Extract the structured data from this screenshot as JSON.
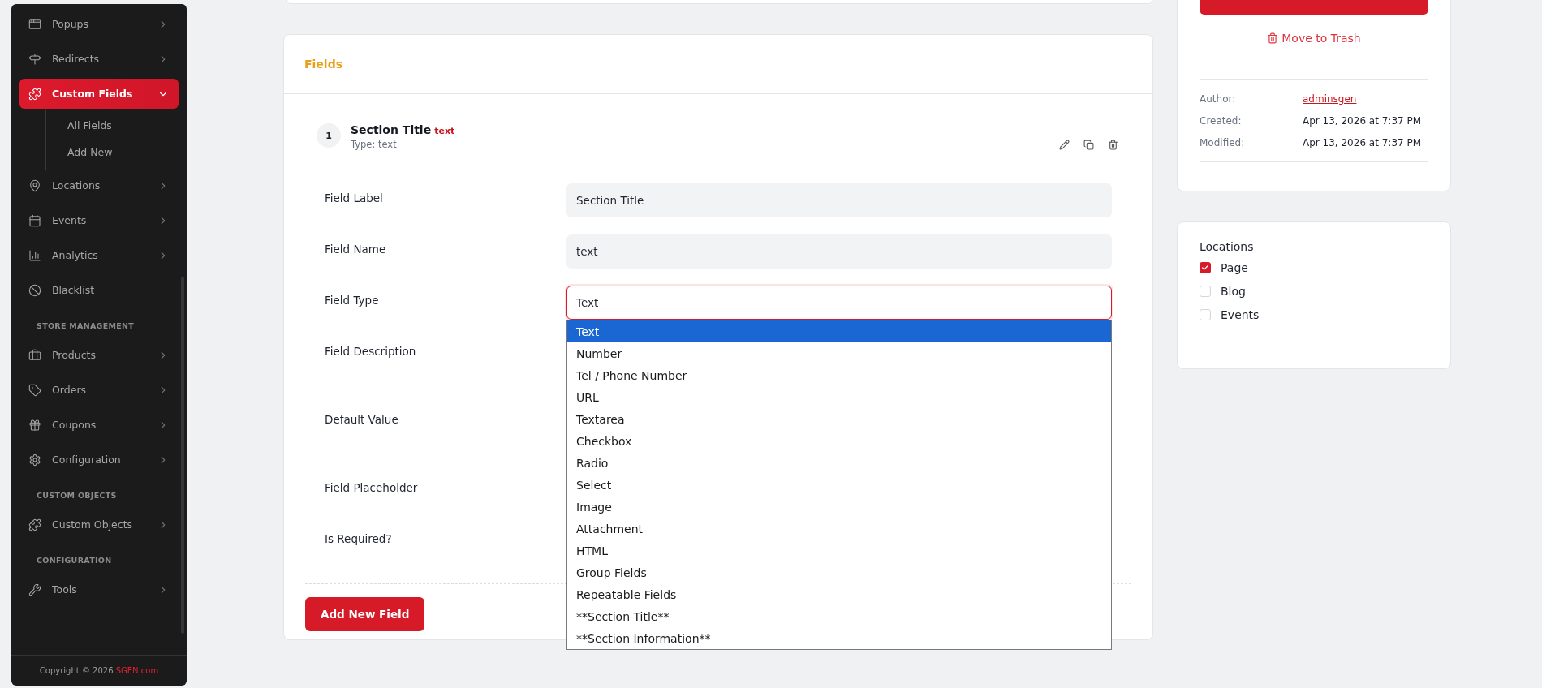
{
  "sidebar": {
    "sections": [
      {
        "items": [
          {
            "label": "Popups",
            "kind": "group",
            "selected": false,
            "expanded": false
          },
          {
            "label": "Redirects",
            "kind": "group",
            "selected": false,
            "expanded": false
          },
          {
            "label": "Custom Fields",
            "kind": "group",
            "selected": true,
            "expanded": true,
            "children": [
              {
                "label": "All Fields"
              },
              {
                "label": "Add New"
              }
            ]
          },
          {
            "label": "Locations",
            "kind": "group",
            "selected": false,
            "expanded": false
          },
          {
            "label": "Events",
            "kind": "group",
            "selected": false,
            "expanded": false
          },
          {
            "label": "Analytics",
            "kind": "group",
            "selected": false,
            "expanded": false
          },
          {
            "label": "Blacklist",
            "kind": "link",
            "selected": false
          }
        ]
      },
      {
        "heading": "STORE MANAGEMENT",
        "items": [
          {
            "label": "Products",
            "kind": "group",
            "selected": false,
            "expanded": false
          },
          {
            "label": "Orders",
            "kind": "group",
            "selected": false,
            "expanded": false
          },
          {
            "label": "Coupons",
            "kind": "group",
            "selected": false,
            "expanded": false
          },
          {
            "label": "Configuration",
            "kind": "group",
            "selected": false,
            "expanded": false
          }
        ]
      },
      {
        "heading": "CUSTOM OBJECTS",
        "items": [
          {
            "label": "Custom Objects",
            "kind": "group",
            "selected": false,
            "expanded": false
          }
        ]
      },
      {
        "heading": "CONFIGURATION",
        "items": [
          {
            "label": "Tools",
            "kind": "group",
            "selected": false,
            "expanded": false
          }
        ]
      }
    ],
    "footer": {
      "text": "Copyright © 2026",
      "link": "SGEN.com"
    }
  },
  "fields_card": {
    "title": "Fields",
    "field": {
      "number": "1",
      "title": "Section Title",
      "tag": "text",
      "subtitle": "Type: text",
      "rows": [
        {
          "label": "Field Label",
          "kind": "input",
          "value": "Section Title"
        },
        {
          "label": "Field Name",
          "kind": "input",
          "value": "text"
        },
        {
          "label": "Field Type",
          "kind": "select",
          "value": "Text",
          "open": true,
          "options": [
            {
              "label": "Text",
              "selected": true
            },
            {
              "label": "Number",
              "selected": false
            },
            {
              "label": "Tel / Phone Number",
              "selected": false
            },
            {
              "label": "URL",
              "selected": false
            },
            {
              "label": "Textarea",
              "selected": false
            },
            {
              "label": "Checkbox",
              "selected": false
            },
            {
              "label": "Radio",
              "selected": false
            },
            {
              "label": "Select",
              "selected": false
            },
            {
              "label": "Image",
              "selected": false
            },
            {
              "label": "Attachment",
              "selected": false
            },
            {
              "label": "HTML",
              "selected": false
            },
            {
              "label": "Group Fields",
              "selected": false
            },
            {
              "label": "Repeatable Fields",
              "selected": false
            },
            {
              "label": "**Section Title**",
              "selected": false
            },
            {
              "label": "**Section Information**",
              "selected": false
            }
          ]
        },
        {
          "label": "Field Description",
          "kind": "covered_tall"
        },
        {
          "label": "Default Value",
          "kind": "covered_tall"
        },
        {
          "label": "Field Placeholder",
          "kind": "covered"
        },
        {
          "label": "Is Required?",
          "kind": "covered"
        }
      ]
    },
    "add_button": "Add New Field"
  },
  "publish_card": {
    "trash_link": "Move to Trash",
    "meta": [
      {
        "label": "Author:",
        "value": "adminsgen",
        "kind": "link"
      },
      {
        "label": "Created:",
        "value": "Apr 13, 2026 at 7:37 PM",
        "kind": "text"
      },
      {
        "label": "Modified:",
        "value": "Apr 13, 2026 at 7:37 PM",
        "kind": "text"
      }
    ]
  },
  "locations_card": {
    "title": "Locations",
    "options": [
      {
        "label": "Page",
        "checked": true
      },
      {
        "label": "Blog",
        "checked": false
      },
      {
        "label": "Events",
        "checked": false
      }
    ]
  }
}
